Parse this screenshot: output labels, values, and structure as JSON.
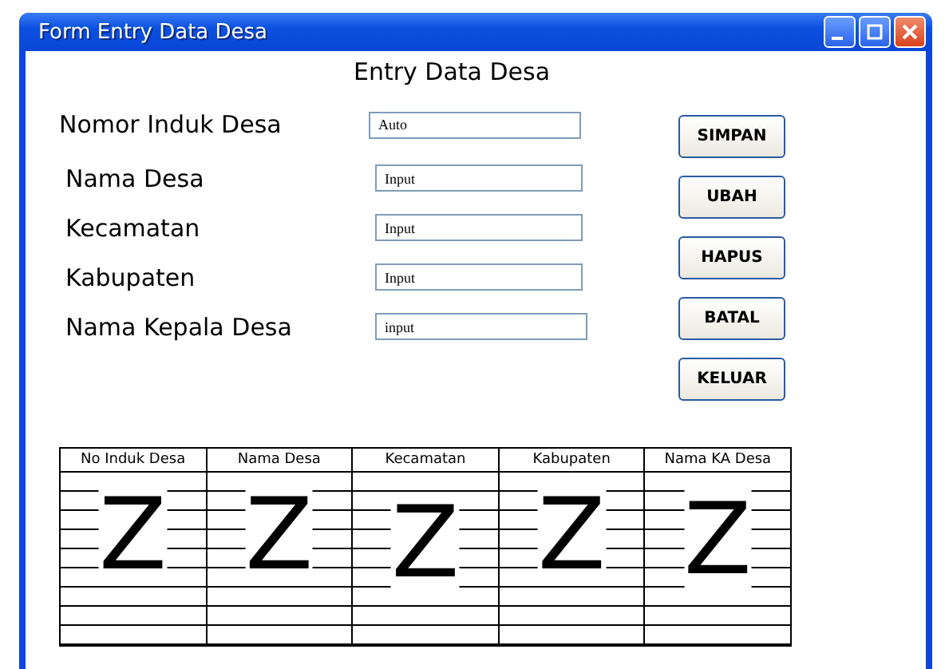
{
  "window": {
    "title": "Form Entry Data Desa"
  },
  "heading": "Entry Data Desa",
  "fields": [
    {
      "label": "Nomor Induk Desa",
      "value": "Auto"
    },
    {
      "label": "Nama Desa",
      "value": "Input"
    },
    {
      "label": "Kecamatan",
      "value": "Input"
    },
    {
      "label": "Kabupaten",
      "value": "Input"
    },
    {
      "label": "Nama Kepala Desa",
      "value": "input"
    }
  ],
  "buttons": [
    "SIMPAN",
    "UBAH",
    "HAPUS",
    "BATAL",
    "KELUAR"
  ],
  "table": {
    "columns": [
      {
        "header": "No Induk Desa",
        "mark": "Z"
      },
      {
        "header": "Nama Desa",
        "mark": "Z"
      },
      {
        "header": "Kecamatan",
        "mark": "Z"
      },
      {
        "header": "Kabupaten",
        "mark": "Z"
      },
      {
        "header": "Nama KA Desa",
        "mark": "Z"
      }
    ]
  }
}
